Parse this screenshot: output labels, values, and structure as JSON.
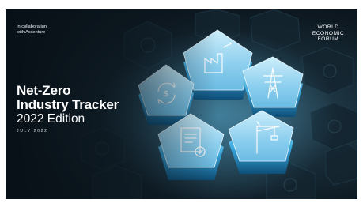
{
  "cover": {
    "collab": [
      "In collaboration",
      "with Accenture"
    ],
    "title": [
      "Net-Zero",
      "Industry Tracker"
    ],
    "edition": "2022 Edition",
    "date": "JULY 2022",
    "publisher": [
      "WORLD",
      "ECONOMIC",
      "FORUM"
    ]
  },
  "icons": [
    "dollar-cycle-icon",
    "factory-icon",
    "power-pylon-icon",
    "document-check-icon",
    "crane-icon"
  ]
}
